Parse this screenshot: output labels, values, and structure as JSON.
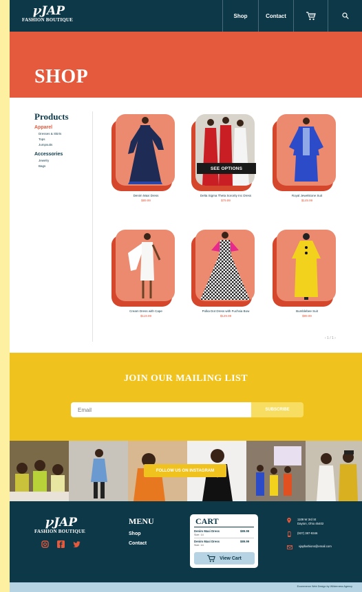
{
  "header": {
    "logo_main": "ꝩJAP",
    "logo_sub": "FASHION BOUTIQUE",
    "nav": [
      "Shop",
      "Contact"
    ],
    "cart_icon": "shopping-cart-icon",
    "search_icon": "search-icon"
  },
  "hero": {
    "title": "SHOP"
  },
  "sidebar": {
    "title": "Products",
    "categories": [
      {
        "label": "Apparel",
        "active": true,
        "sub": [
          "Dresses & Skirts",
          "Tops",
          "Jumpsuits"
        ]
      },
      {
        "label": "Accessories",
        "active": false,
        "sub": [
          "Jewelry",
          "Bags"
        ]
      }
    ]
  },
  "products": [
    {
      "name": "Denim Maxi Dress",
      "price": "$89.99"
    },
    {
      "name": "Delta Sigma Theta Sorority Inc Dress",
      "price": "$79.99"
    },
    {
      "name": "Royal Jewelstone Suit",
      "price": "$149.99"
    },
    {
      "name": "Cream Dress with Cape",
      "price": "$119.99"
    },
    {
      "name": "Polka Dot Dress with Fuchsia Bow",
      "price": "$129.99"
    },
    {
      "name": "Bumblebee Suit",
      "price": "$99.99"
    }
  ],
  "see_options": "SEE OPTIONS",
  "pager": "‹ 1 / 1 ›",
  "mailing": {
    "title": "JOIN OUR MAILING LIST",
    "email_placeholder": "Email",
    "subscribe": "SUBSCRIBE"
  },
  "instagram": {
    "follow": "FOLLOW US ON INSTAGRAM"
  },
  "footer": {
    "logo_main": "ꝩJAP",
    "logo_sub": "FASHION BOUTIQUE",
    "social": [
      "instagram-icon",
      "facebook-icon",
      "twitter-icon"
    ],
    "menu_title": "MENU",
    "menu_links": [
      "Shop",
      "Contact"
    ],
    "cart": {
      "title": "CART",
      "items": [
        {
          "name": "Denim Maxi Dress",
          "size": "Size: 14",
          "price": "$89.99"
        },
        {
          "name": "Denim Maxi Dress",
          "size": "Size: 14",
          "price": "$89.99"
        }
      ],
      "view_cart": "View Cart"
    },
    "contact": {
      "address_line1": "1108 W 3rd St",
      "address_line2": "Dayton, Ohio 45402",
      "phone": "(937) 387-9346",
      "email": "vjapfashions@email.com"
    },
    "credit": "Ecommerce Web Design by Wilderness Agency"
  },
  "colors": {
    "navy": "#0d3848",
    "coral": "#e5593c",
    "yellow": "#f0c21d",
    "light_blue": "#b5d3e2"
  }
}
